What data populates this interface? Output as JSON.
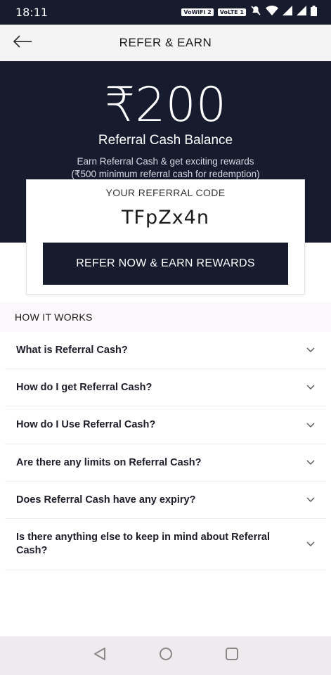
{
  "status_bar": {
    "time": "18:11",
    "badges": [
      "VoWiFi 2",
      "VoLTE 1"
    ]
  },
  "app_bar": {
    "title": "REFER & EARN"
  },
  "hero": {
    "amount": "₹200",
    "balance_label": "Referral Cash Balance",
    "subtitle_line1": "Earn Referral Cash & get exciting rewards",
    "subtitle_line2": "(₹500 minimum referral cash for redemption)"
  },
  "referral": {
    "code_label": "YOUR REFERRAL CODE",
    "code": "TFpZx4n",
    "button_label": "REFER NOW & EARN REWARDS"
  },
  "how_it_works": {
    "heading": "HOW IT WORKS",
    "faqs": [
      {
        "question": "What is Referral Cash?"
      },
      {
        "question": "How do I get Referral Cash?"
      },
      {
        "question": "How do I Use Referral Cash?"
      },
      {
        "question": "Are there any limits on Referral Cash?"
      },
      {
        "question": "Does Referral Cash have any expiry?"
      },
      {
        "question": "Is there anything else to keep in mind about Referral Cash?"
      }
    ]
  },
  "colors": {
    "primary_dark": "#161b2e",
    "section_bg": "#fcf7fa",
    "nav_bg": "#eeeaee"
  },
  "icons": {
    "back": "arrow-left-icon",
    "chevron": "chevron-down-icon",
    "nav_back": "triangle-back-icon",
    "nav_home": "circle-home-icon",
    "nav_recents": "square-recents-icon"
  }
}
